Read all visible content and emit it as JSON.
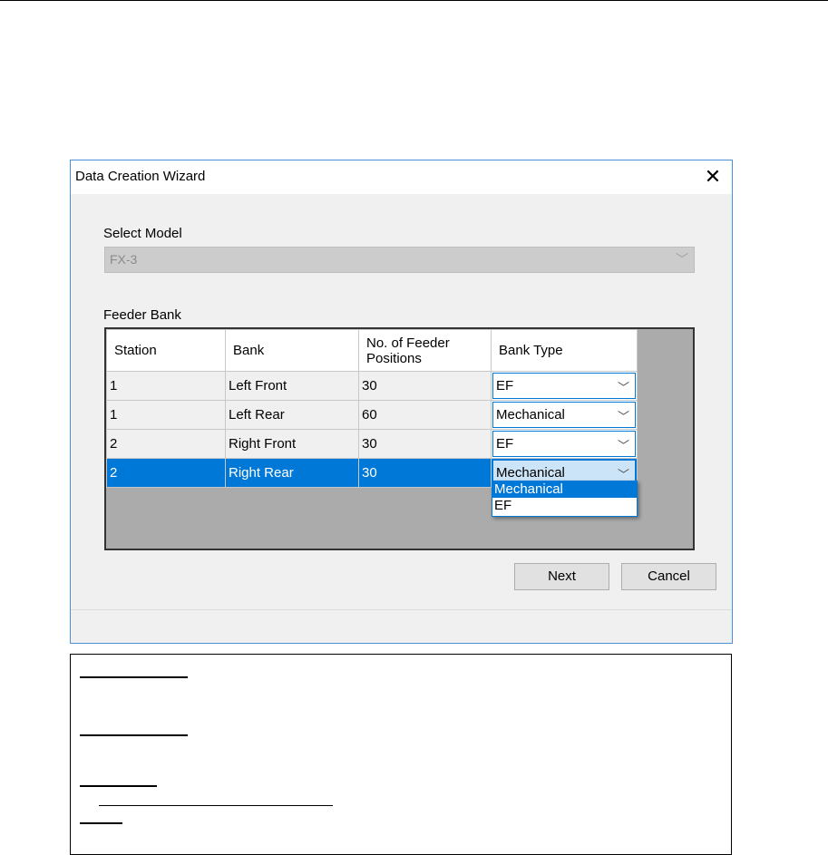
{
  "dialog": {
    "title": "Data Creation Wizard",
    "close_icon": "close-icon",
    "select_model_label": "Select Model",
    "model_value": "FX-3",
    "feeder_bank_label": "Feeder Bank",
    "columns": [
      "Station",
      "Bank",
      "No. of Feeder Positions",
      "Bank Type"
    ],
    "rows": [
      {
        "station": "1",
        "bank": "Left Front",
        "positions": "30",
        "bank_type": "EF"
      },
      {
        "station": "1",
        "bank": "Left Rear",
        "positions": "60",
        "bank_type": "Mechanical"
      },
      {
        "station": "2",
        "bank": "Right Front",
        "positions": "30",
        "bank_type": "EF"
      },
      {
        "station": "2",
        "bank": "Right Rear",
        "positions": "30",
        "bank_type": "Mechanical"
      }
    ],
    "dropdown_options": [
      "Mechanical",
      "EF"
    ],
    "next_label": "Next",
    "cancel_label": "Cancel",
    "accent": "#0078d7"
  }
}
